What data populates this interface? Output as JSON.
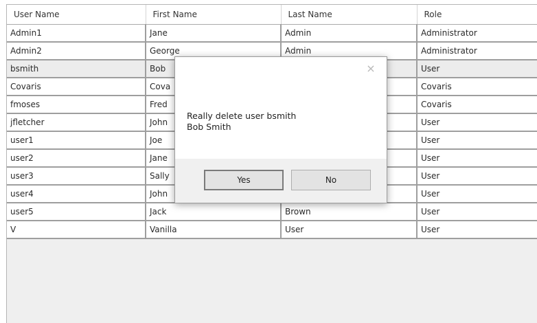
{
  "grid": {
    "columns": [
      "User Name",
      "First Name",
      "Last Name",
      "Role"
    ],
    "rows": [
      [
        "Admin1",
        "Jane",
        "Admin",
        "Administrator"
      ],
      [
        "Admin2",
        "George",
        "Admin",
        "Administrator"
      ],
      [
        "bsmith",
        "Bob",
        "",
        "User"
      ],
      [
        "Covaris",
        "Cova",
        "",
        "Covaris"
      ],
      [
        "fmoses",
        "Fred",
        "",
        "Covaris"
      ],
      [
        "jfletcher",
        "John",
        "",
        "User"
      ],
      [
        "user1",
        "Joe",
        "",
        "User"
      ],
      [
        "user2",
        "Jane",
        "",
        "User"
      ],
      [
        "user3",
        "Sally",
        "",
        "User"
      ],
      [
        "user4",
        "John",
        "",
        "User"
      ],
      [
        "user5",
        "Jack",
        "Brown",
        "User"
      ],
      [
        "V",
        "Vanilla",
        "User",
        "User"
      ]
    ],
    "selected_row": 2
  },
  "dialog": {
    "close_icon": "×",
    "message_line1": "Really delete user bsmith",
    "message_line2": "Bob Smith",
    "yes_label": "Yes",
    "no_label": "No"
  }
}
